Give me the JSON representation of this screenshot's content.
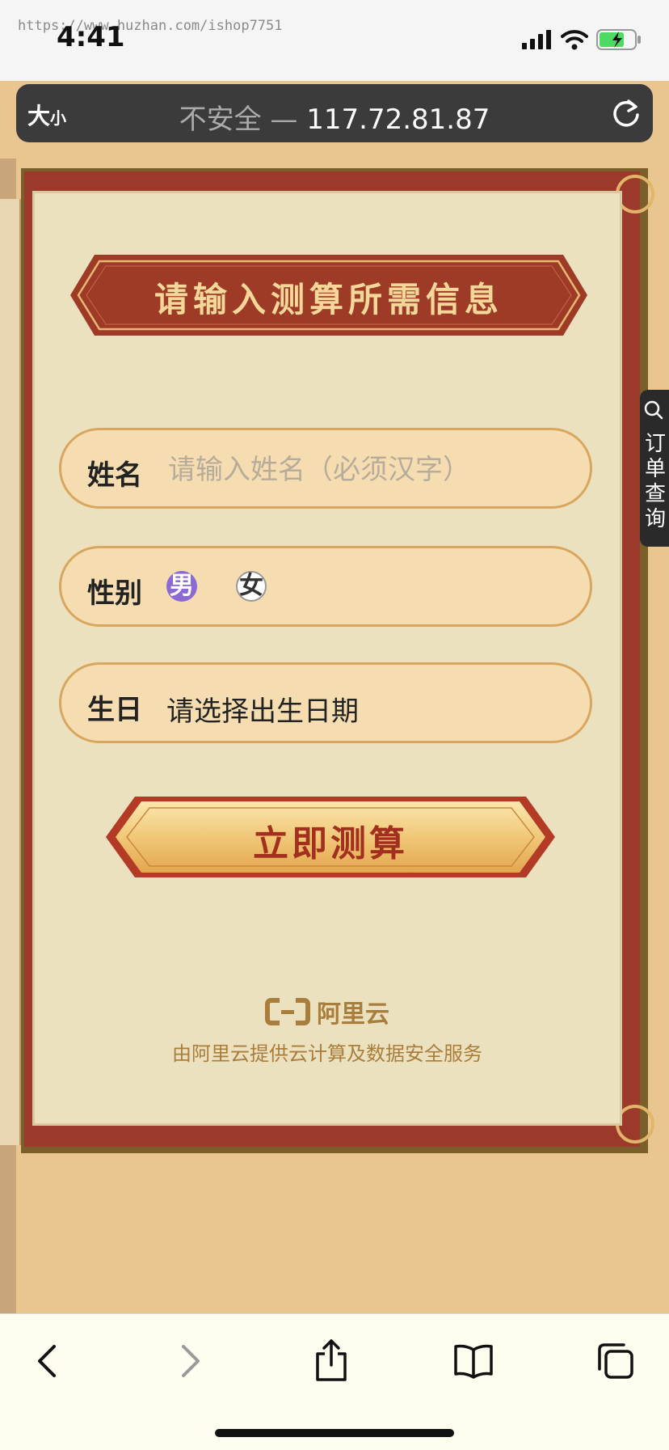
{
  "status_bar": {
    "watermark": "https://www.huzhan.com/ishop7751",
    "time": "4:41"
  },
  "address_bar": {
    "text_size_big": "大",
    "text_size_small": "小",
    "insecure_label": "不安全 — ",
    "host": "117.72.81.87"
  },
  "form": {
    "title": "请输入测算所需信息",
    "name_label": "姓名",
    "name_placeholder": "请输入姓名（必须汉字）",
    "gender_label": "性别",
    "gender_male": "男",
    "gender_female": "女",
    "birthday_label": "生日",
    "birthday_value": "请选择出生日期",
    "submit_label": "立即测算"
  },
  "footer": {
    "brand": "阿里云",
    "note": "由阿里云提供云计算及数据安全服务"
  },
  "order_tab": {
    "label": "订单查询"
  },
  "colors": {
    "accent_red": "#9b3a2a",
    "paper": "#ece1bf",
    "field_bg": "#f6ddb1",
    "gold": "#a97d3c",
    "male_selected": "#8b6ad3"
  }
}
